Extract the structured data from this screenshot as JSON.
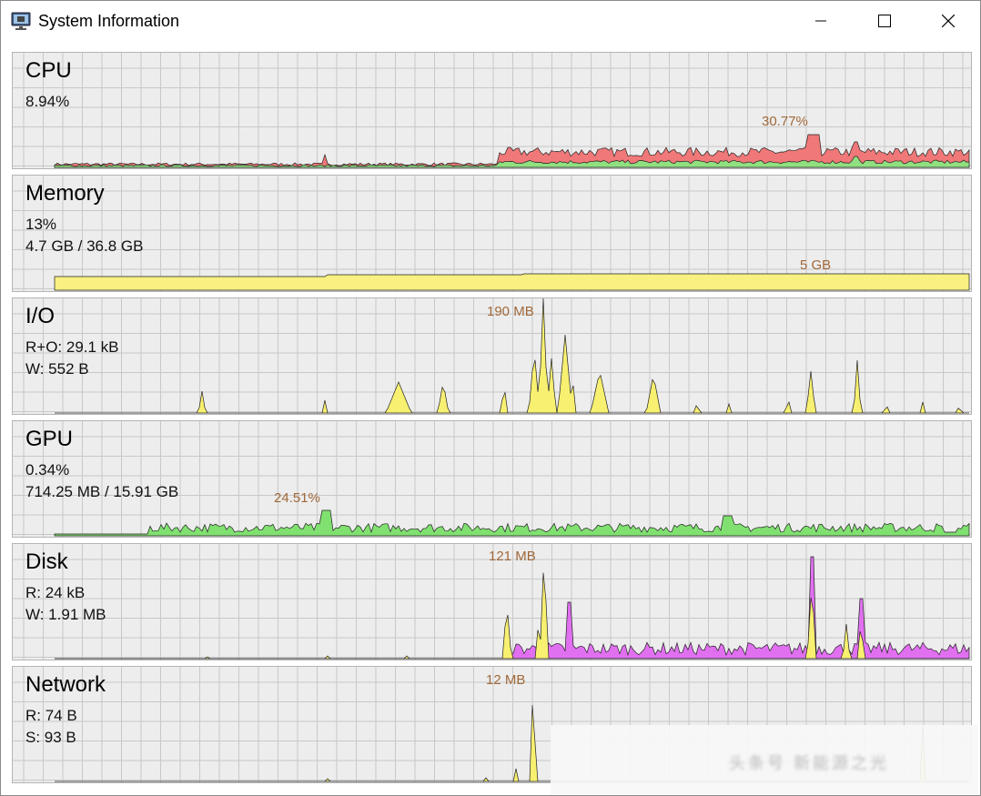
{
  "window": {
    "title": "System Information",
    "app_icon": "monitor-chip-icon",
    "controls": {
      "minimize": "minimize-icon",
      "maximize": "maximize-icon",
      "close": "close-icon"
    }
  },
  "panels": [
    {
      "id": "cpu",
      "title": "CPU",
      "line1": "8.94%",
      "line2": "",
      "peak_label": "30.77%",
      "fill_colors": [
        "#f07878",
        "#90e080"
      ]
    },
    {
      "id": "memory",
      "title": "Memory",
      "line1": "13%",
      "line2": "4.7 GB / 36.8 GB",
      "peak_label": "5 GB",
      "fill_colors": [
        "#f8f080"
      ]
    },
    {
      "id": "io",
      "title": "I/O",
      "line1": "R+O: 29.1 kB",
      "line2": "W: 552 B",
      "peak_label": "190 MB",
      "fill_colors": [
        "#f8f070"
      ]
    },
    {
      "id": "gpu",
      "title": "GPU",
      "line1": "0.34%",
      "line2": "714.25 MB / 15.91 GB",
      "peak_label": "24.51%",
      "fill_colors": [
        "#80e070"
      ]
    },
    {
      "id": "disk",
      "title": "Disk",
      "line1": "R: 24 kB",
      "line2": "W: 1.91 MB",
      "peak_label": "121 MB",
      "fill_colors": [
        "#f8f070",
        "#e070f0"
      ]
    },
    {
      "id": "network",
      "title": "Network",
      "line1": "R: 74 B",
      "line2": "S: 93 B",
      "peak_label": "12 MB",
      "fill_colors": [
        "#f8f070"
      ]
    }
  ],
  "watermark": "头条号 新能源之光"
}
